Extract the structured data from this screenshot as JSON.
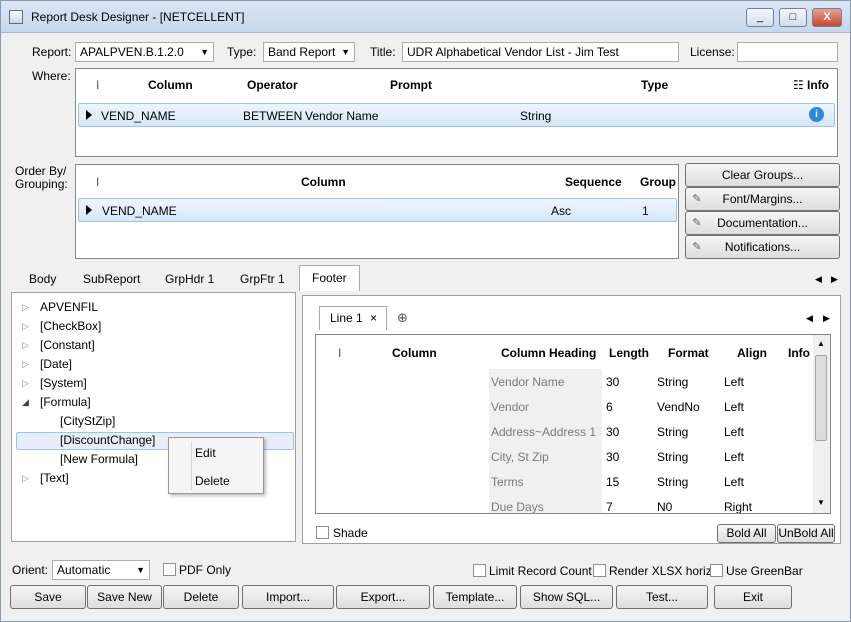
{
  "window": {
    "title": "Report Desk Designer - [NETCELLENT]",
    "controls": [
      "_",
      "□",
      "X"
    ]
  },
  "header": {
    "report_label": "Report:",
    "report_value": "APALPVEN.B.1.2.0",
    "type_label": "Type:",
    "type_value": "Band Report",
    "title_label": "Title:",
    "title_value": "UDR Alphabetical Vendor List - Jim Test",
    "license_label": "License:",
    "license_value": ""
  },
  "where": {
    "label": "Where:",
    "columns": [
      "Column",
      "Operator",
      "Prompt",
      "Type",
      "Info"
    ],
    "rows": [
      {
        "column": "VEND_NAME",
        "operator": "BETWEEN",
        "prompt": "Vendor Name",
        "type": "String"
      }
    ]
  },
  "order": {
    "label_line1": "Order By/",
    "label_line2": "Grouping:",
    "columns": [
      "Column",
      "Sequence",
      "Group"
    ],
    "rows": [
      {
        "column": "VEND_NAME",
        "sequence": "Asc",
        "group": "1"
      }
    ]
  },
  "side_buttons": [
    "Clear Groups...",
    "Font/Margins...",
    "Documentation...",
    "Notifications..."
  ],
  "tabs": [
    "Body",
    "SubReport",
    "GrpHdr 1",
    "GrpFtr 1",
    "Footer"
  ],
  "tree": [
    {
      "label": "APVENFIL",
      "expanded": false
    },
    {
      "label": "[CheckBox]",
      "expanded": false
    },
    {
      "label": "[Constant]",
      "expanded": false
    },
    {
      "label": "[Date]",
      "expanded": false
    },
    {
      "label": "[System]",
      "expanded": false
    },
    {
      "label": "[Formula]",
      "expanded": true
    },
    {
      "label": "[CityStZip]",
      "child": true
    },
    {
      "label": "[DiscountChange]",
      "child": true
    },
    {
      "label": "[New Formula]",
      "child": true
    },
    {
      "label": "[Text]",
      "expanded": false
    }
  ],
  "context_menu": [
    "Edit",
    "Delete"
  ],
  "line_tab": {
    "label": "Line 1",
    "close": "×"
  },
  "line_grid": {
    "columns": [
      "Column",
      "Column Heading",
      "Length",
      "Format",
      "Align",
      "Info"
    ],
    "rows": [
      {
        "heading": "Vendor Name",
        "length": "30",
        "format": "String",
        "align": "Left"
      },
      {
        "heading": "Vendor",
        "length": "6",
        "format": "VendNo",
        "align": "Left"
      },
      {
        "heading": "Address~Address 1",
        "length": "30",
        "format": "String",
        "align": "Left"
      },
      {
        "heading": "City, St Zip",
        "length": "30",
        "format": "String",
        "align": "Left"
      },
      {
        "heading": "Terms",
        "length": "15",
        "format": "String",
        "align": "Left"
      },
      {
        "heading": "Due Days",
        "length": "7",
        "format": "N0",
        "align": "Right"
      }
    ]
  },
  "shade_label": "Shade",
  "bold_all": "Bold All",
  "unbold_all": "UnBold All",
  "orient": {
    "label": "Orient:",
    "value": "Automatic"
  },
  "options": {
    "pdf_only": "PDF Only",
    "limit_record": "Limit Record Count",
    "render_xlsx": "Render XLSX horiz.",
    "use_greenbar": "Use GreenBar"
  },
  "bottom_buttons": [
    "Save",
    "Save New",
    "Delete",
    "Import...",
    "Export...",
    "Template...",
    "Show SQL...",
    "Test...",
    "Exit"
  ]
}
